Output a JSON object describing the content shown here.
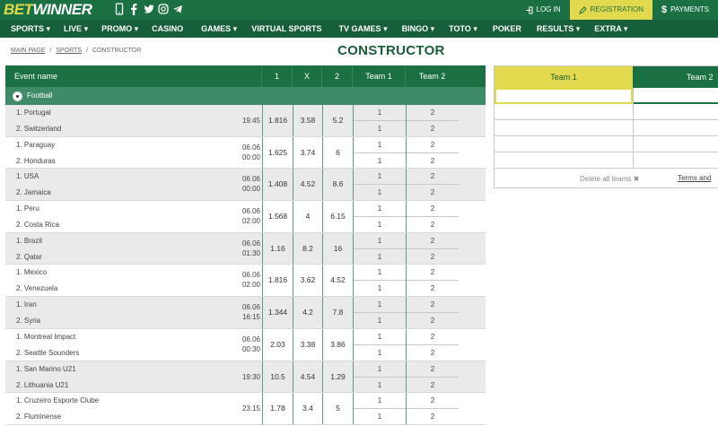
{
  "brand": {
    "bet": "BET",
    "winner": "WINNER"
  },
  "header": {
    "login_label": "LOG IN",
    "register_label": "REGISTRATION",
    "payments_label": "PAYMENTS",
    "social_icons": [
      "phone-icon",
      "facebook-icon",
      "twitter-icon",
      "instagram-icon",
      "telegram-icon"
    ]
  },
  "nav": {
    "items": [
      {
        "label": "SPORTS",
        "dropdown": true
      },
      {
        "label": "LIVE",
        "dropdown": true
      },
      {
        "label": "PROMO",
        "dropdown": true
      },
      {
        "label": "CASINO",
        "dropdown": false
      },
      {
        "label": "GAMES",
        "dropdown": true
      },
      {
        "label": "VIRTUAL SPORTS",
        "dropdown": false
      },
      {
        "label": "TV GAMES",
        "dropdown": true
      },
      {
        "label": "BINGO",
        "dropdown": true
      },
      {
        "label": "TOTO",
        "dropdown": true
      },
      {
        "label": "POKER",
        "dropdown": false
      },
      {
        "label": "RESULTS",
        "dropdown": true
      },
      {
        "label": "EXTRA",
        "dropdown": true
      }
    ]
  },
  "breadcrumb": {
    "main": "MAIN PAGE",
    "sports": "SPORTS",
    "current": "CONSTRUCTOR"
  },
  "page_title": "CONSTRUCTOR",
  "table": {
    "headers": {
      "event": "Event name",
      "one": "1",
      "x": "X",
      "two": "2",
      "team1": "Team 1",
      "team2": "Team 2"
    },
    "sport": "Football",
    "matches": [
      {
        "team1": "1. Portugal",
        "team2": "2. Switzerland",
        "date": "",
        "time": "19:45",
        "o1": "1.816",
        "ox": "3.58",
        "o2": "5.2"
      },
      {
        "team1": "1. Paraguay",
        "team2": "2. Honduras",
        "date": "06.06",
        "time": "00:00",
        "o1": "1.625",
        "ox": "3.74",
        "o2": "6"
      },
      {
        "team1": "1. USA",
        "team2": "2. Jamaica",
        "date": "06.06",
        "time": "00:00",
        "o1": "1.408",
        "ox": "4.52",
        "o2": "8.6"
      },
      {
        "team1": "1. Peru",
        "team2": "2. Costa Rica",
        "date": "06.06",
        "time": "02:00",
        "o1": "1.568",
        "ox": "4",
        "o2": "6.15"
      },
      {
        "team1": "1. Brazil",
        "team2": "2. Qatar",
        "date": "06.06",
        "time": "01:30",
        "o1": "1.16",
        "ox": "8.2",
        "o2": "16"
      },
      {
        "team1": "1. Mexico",
        "team2": "2. Venezuela",
        "date": "06.06",
        "time": "02:00",
        "o1": "1.816",
        "ox": "3.62",
        "o2": "4.52"
      },
      {
        "team1": "1. Iran",
        "team2": "2. Syria",
        "date": "06.06",
        "time": "16:15",
        "o1": "1.344",
        "ox": "4.2",
        "o2": "7.8"
      },
      {
        "team1": "1. Montreal Impact",
        "team2": "2. Seattle Sounders",
        "date": "06.06",
        "time": "00:30",
        "o1": "2.03",
        "ox": "3.38",
        "o2": "3.86"
      },
      {
        "team1": "1. San Marino U21",
        "team2": "2. Lithuania U21",
        "date": "",
        "time": "19:30",
        "o1": "10.5",
        "ox": "4.54",
        "o2": "1.29"
      },
      {
        "team1": "1. Cruzeiro Esporte Clube",
        "team2": "2. Fluminense",
        "date": "",
        "time": "23:15",
        "o1": "1.78",
        "ox": "3.4",
        "o2": "5"
      }
    ],
    "team_pick_1": "1",
    "team_pick_2": "2"
  },
  "constructor_panel": {
    "team1_header": "Team 1",
    "team2_header": "Team 2",
    "delete_all": "Delete all teams",
    "terms": "Terms and"
  },
  "colors": {
    "brand_green": "#1a7042",
    "accent_yellow": "#e3d94f",
    "title_green": "#1a5c3a"
  }
}
